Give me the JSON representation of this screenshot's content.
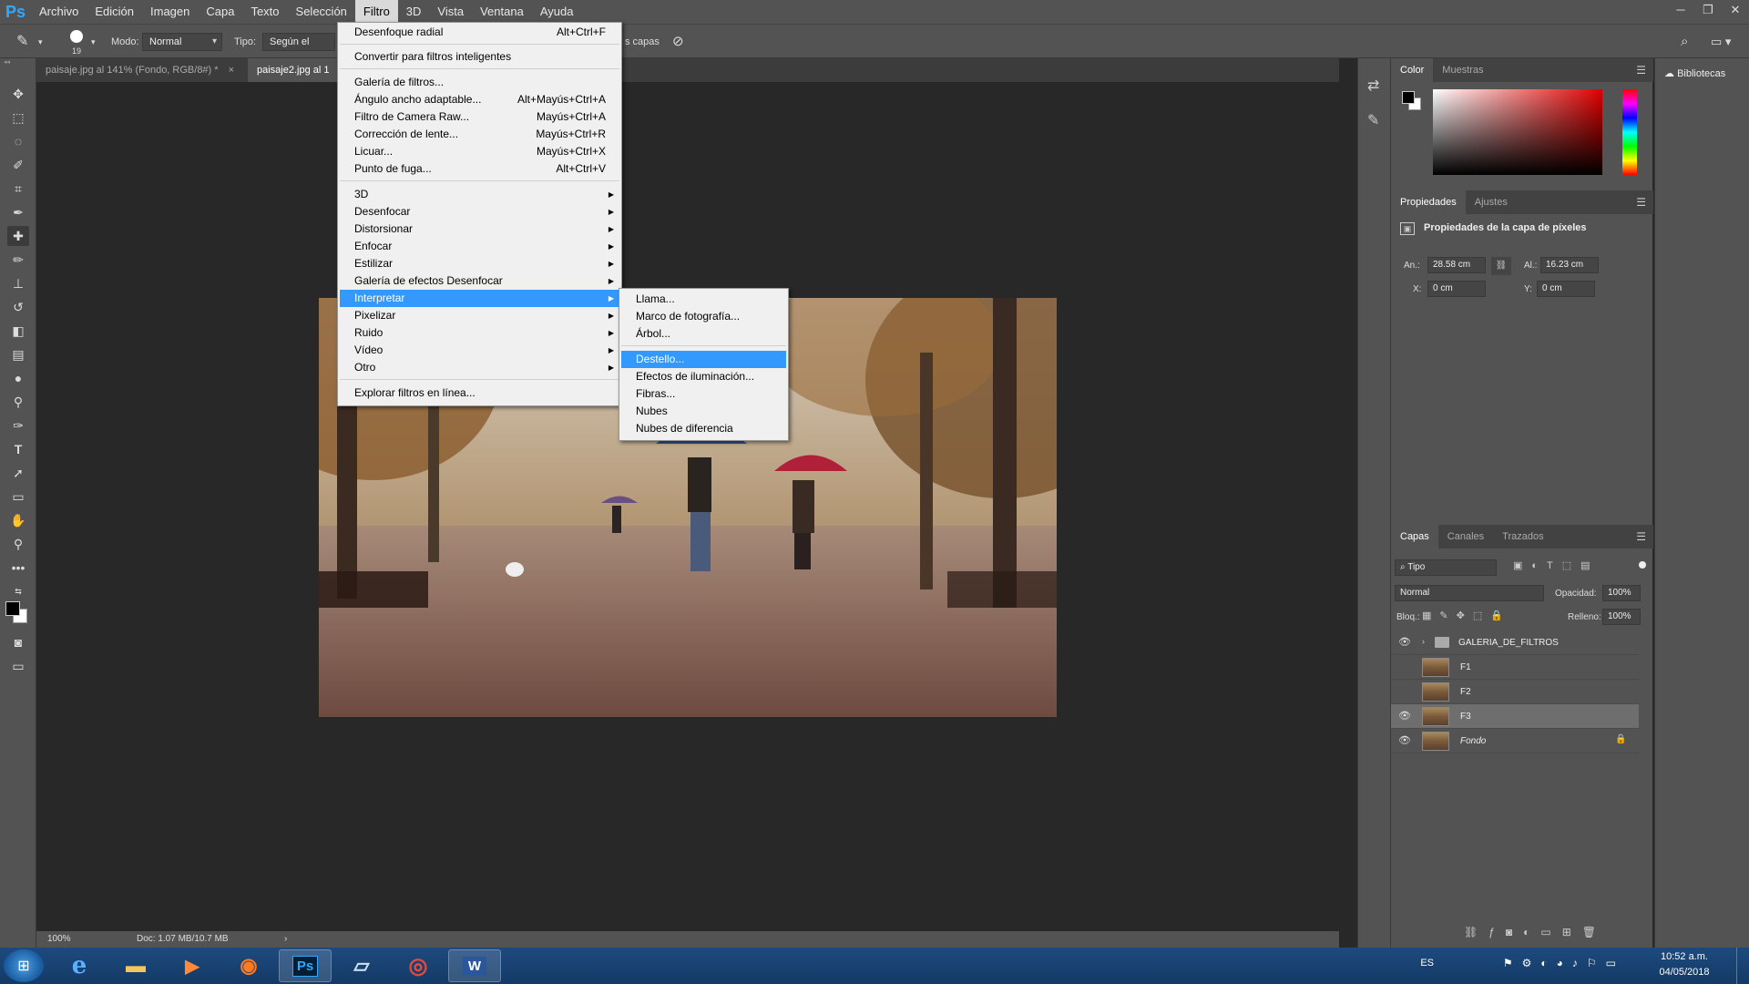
{
  "app": {
    "logo": "Ps",
    "menu": [
      "Archivo",
      "Edición",
      "Imagen",
      "Capa",
      "Texto",
      "Selección",
      "Filtro",
      "3D",
      "Vista",
      "Ventana",
      "Ayuda"
    ],
    "active_menu": "Filtro"
  },
  "options_bar": {
    "brush_size": "19",
    "mode_label": "Modo:",
    "mode_value": "Normal",
    "type_label": "Tipo:",
    "type_value": "Según el conten",
    "layers_option": "s capas"
  },
  "tabs": [
    {
      "label": "paisaje.jpg al 141% (Fondo, RGB/8#) *",
      "close": "×"
    },
    {
      "label": "paisaje2.jpg al 1"
    }
  ],
  "filter_menu": {
    "items": [
      {
        "label": "Desenfoque radial",
        "shortcut": "Alt+Ctrl+F"
      },
      {
        "label": "Convertir para filtros inteligentes"
      },
      {
        "label": "Galería de filtros..."
      },
      {
        "label": "Ángulo ancho adaptable...",
        "shortcut": "Alt+Mayús+Ctrl+A"
      },
      {
        "label": "Filtro de Camera Raw...",
        "shortcut": "Mayús+Ctrl+A"
      },
      {
        "label": "Corrección de lente...",
        "shortcut": "Mayús+Ctrl+R"
      },
      {
        "label": "Licuar...",
        "shortcut": "Mayús+Ctrl+X"
      },
      {
        "label": "Punto de fuga...",
        "shortcut": "Alt+Ctrl+V"
      },
      {
        "label": "3D"
      },
      {
        "label": "Desenfocar"
      },
      {
        "label": "Distorsionar"
      },
      {
        "label": "Enfocar"
      },
      {
        "label": "Estilizar"
      },
      {
        "label": "Galería de efectos Desenfocar"
      },
      {
        "label": "Interpretar"
      },
      {
        "label": "Pixelizar"
      },
      {
        "label": "Ruido"
      },
      {
        "label": "Vídeo"
      },
      {
        "label": "Otro"
      },
      {
        "label": "Explorar filtros en línea..."
      }
    ]
  },
  "render_submenu": {
    "items": [
      "Llama...",
      "Marco de fotografía...",
      "Árbol...",
      "Destello...",
      "Efectos de iluminación...",
      "Fibras...",
      "Nubes",
      "Nubes de diferencia"
    ]
  },
  "status": {
    "zoom": "100%",
    "doc": "Doc: 1.07 MB/10.7 MB"
  },
  "color_panel": {
    "tabs": [
      "Color",
      "Muestras"
    ],
    "fg_color": "#000000",
    "bg_color": "#ffffff"
  },
  "properties_panel": {
    "tabs": [
      "Propiedades",
      "Ajustes"
    ],
    "title": "Propiedades de la capa de píxeles",
    "width_label": "An.:",
    "width_value": "28.58 cm",
    "height_label": "Al.:",
    "height_value": "16.23 cm",
    "x_label": "X:",
    "x_value": "0 cm",
    "y_label": "Y:",
    "y_value": "0 cm"
  },
  "libraries": {
    "label": "Bibliotecas"
  },
  "layers_panel": {
    "tabs": [
      "Capas",
      "Canales",
      "Trazados"
    ],
    "filter_label": "Tipo",
    "blend_mode": "Normal",
    "opacity_label": "Opacidad:",
    "opacity_value": "100%",
    "lock_label": "Bloq.:",
    "fill_label": "Relleno:",
    "fill_value": "100%",
    "layers": [
      {
        "name": "GALERIA_DE_FILTROS",
        "visible": true,
        "type": "group"
      },
      {
        "name": "F1",
        "visible": false
      },
      {
        "name": "F2",
        "visible": false
      },
      {
        "name": "F3",
        "visible": true,
        "selected": true
      },
      {
        "name": "Fondo",
        "visible": true,
        "locked": true
      }
    ]
  },
  "taskbar": {
    "lang": "ES",
    "time": "10:52 a.m.",
    "date": "04/05/2018",
    "apps": [
      "ie",
      "explorer",
      "media",
      "firefox",
      "photoshop",
      "notepad",
      "chrome",
      "word"
    ]
  }
}
